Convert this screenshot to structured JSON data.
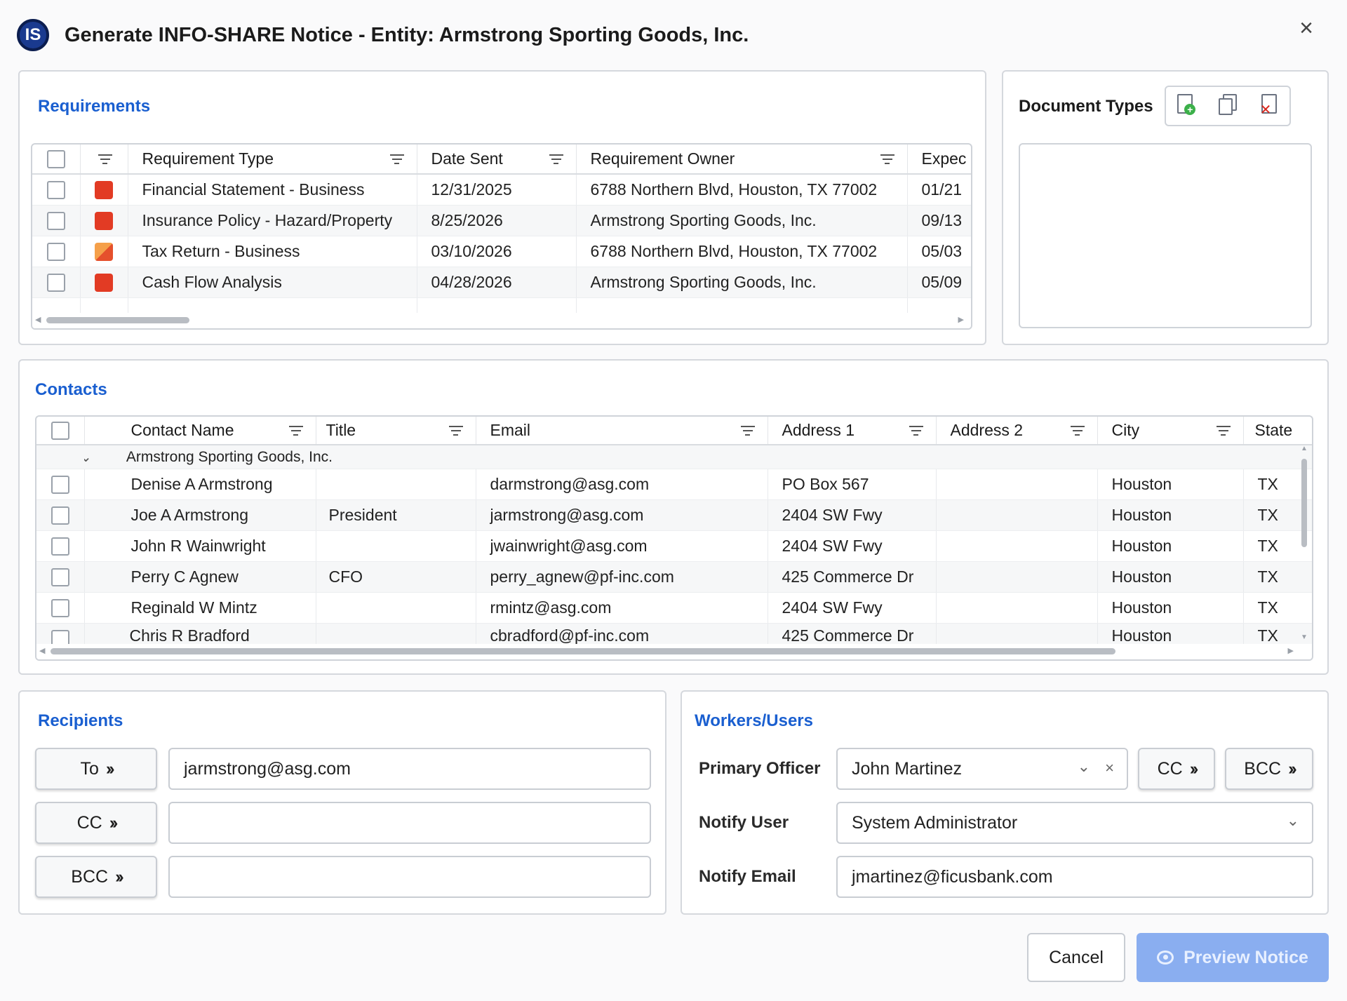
{
  "dialog": {
    "logo": "IS",
    "title": "Generate INFO-SHARE Notice - Entity: Armstrong Sporting Goods, Inc.",
    "close_icon": "×"
  },
  "requirements": {
    "title": "Requirements",
    "columns": [
      "Requirement Type",
      "Date Sent",
      "Requirement Owner",
      "Expec"
    ],
    "rows": [
      {
        "type": "Financial Statement - Business",
        "date_sent": "12/31/2025",
        "owner": "6788 Northern Blvd, Houston, TX 77002",
        "expected": "01/21",
        "status_color": "#e23b24"
      },
      {
        "type": "Insurance Policy - Hazard/Property",
        "date_sent": "8/25/2026",
        "owner": "Armstrong Sporting Goods, Inc.",
        "expected": "09/13",
        "status_color": "#e23b24"
      },
      {
        "type": "Tax Return - Business",
        "date_sent": "03/10/2026",
        "owner": "6788 Northern Blvd, Houston, TX 77002",
        "expected": "05/03",
        "status_color": "#f08a3a"
      },
      {
        "type": "Cash Flow Analysis",
        "date_sent": "04/28/2026",
        "owner": "Armstrong Sporting Goods, Inc.",
        "expected": "05/09",
        "status_color": "#e23b24"
      }
    ]
  },
  "document_types": {
    "title": "Document Types",
    "icons": [
      "add-document-icon",
      "copy-document-icon",
      "delete-document-icon"
    ]
  },
  "contacts": {
    "title": "Contacts",
    "columns": [
      "Contact Name",
      "Title",
      "Email",
      "Address 1",
      "Address 2",
      "City",
      "State"
    ],
    "group_label": "Armstrong Sporting Goods, Inc.",
    "rows": [
      {
        "name": "Denise A Armstrong",
        "title": "",
        "email": "darmstrong@asg.com",
        "address1": "PO Box 567",
        "address2": "",
        "city": "Houston",
        "state": "TX"
      },
      {
        "name": "Joe A Armstrong",
        "title": "President",
        "email": "jarmstrong@asg.com",
        "address1": "2404 SW Fwy",
        "address2": "",
        "city": "Houston",
        "state": "TX"
      },
      {
        "name": "John R Wainwright",
        "title": "",
        "email": "jwainwright@asg.com",
        "address1": "2404 SW Fwy",
        "address2": "",
        "city": "Houston",
        "state": "TX"
      },
      {
        "name": "Perry C Agnew",
        "title": "CFO",
        "email": "perry_agnew@pf-inc.com",
        "address1": "425 Commerce Dr",
        "address2": "",
        "city": "Houston",
        "state": "TX"
      },
      {
        "name": "Reginald W Mintz",
        "title": "",
        "email": "rmintz@asg.com",
        "address1": "2404 SW Fwy",
        "address2": "",
        "city": "Houston",
        "state": "TX"
      },
      {
        "name": "Chris R Bradford",
        "title": "",
        "email": "cbradford@pf-inc.com",
        "address1": "425 Commerce Dr",
        "address2": "",
        "city": "Houston",
        "state": "TX"
      }
    ]
  },
  "recipients": {
    "title": "Recipients",
    "to_label": "To",
    "cc_label": "CC",
    "bcc_label": "BCC",
    "to_value": "jarmstrong@asg.com",
    "cc_value": "",
    "bcc_value": ""
  },
  "workers": {
    "title": "Workers/Users",
    "primary_officer_label": "Primary Officer",
    "primary_officer_value": "John Martinez",
    "cc_label": "CC",
    "bcc_label": "BCC",
    "notify_user_label": "Notify User",
    "notify_user_value": "System Administrator",
    "notify_email_label": "Notify Email",
    "notify_email_value": "jmartinez@ficusbank.com"
  },
  "footer": {
    "cancel_label": "Cancel",
    "preview_label": "Preview Notice"
  },
  "colors": {
    "accent": "#1a5fd0",
    "primary_button": "#8aaef0",
    "status_red": "#e23b24",
    "status_orange": "#f08a3a"
  }
}
